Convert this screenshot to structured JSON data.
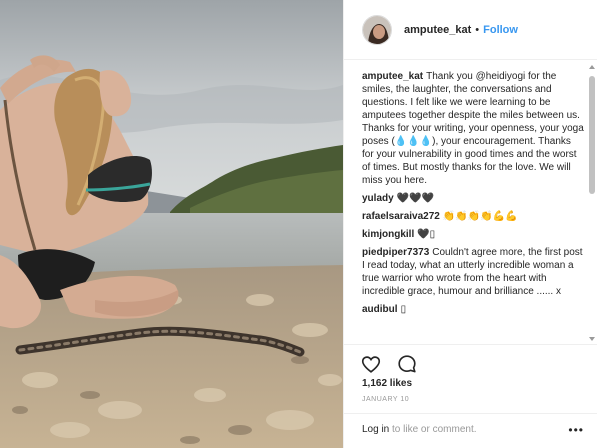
{
  "post": {
    "username": "amputee_kat",
    "separator": "•",
    "follow_label": "Follow"
  },
  "comments": [
    {
      "user": "amputee_kat",
      "text": "Thank you @heidiyogi for the smiles, the laughter, the conversations and questions. I felt like we were learning to be amputees together despite the miles between us. Thanks for your writing, your openness, your yoga poses (💧💧💧), your encouragement. Thanks for your vulnerability in good times and the worst of times. But mostly thanks for the love. We will miss you here."
    },
    {
      "user": "yulady",
      "text": "🖤🖤🖤"
    },
    {
      "user": "rafaelsaraiva272",
      "text": "👏👏👏👏💪💪"
    },
    {
      "user": "kimjongkill",
      "text": "🖤▯"
    },
    {
      "user": "piedpiper7373",
      "text": "Couldn't agree more, the first post I read today, what an utterly incredible woman a true warrior who wrote from the heart with incredible grace, humour and brilliance ...... x"
    },
    {
      "user": "audibul",
      "text": "▯"
    }
  ],
  "actions": {
    "likes": "1,162 likes",
    "date": "JANUARY 10",
    "login_link": "Log in",
    "login_rest": " to like or comment.",
    "more": "•••"
  },
  "icons": {
    "like": "heart-icon",
    "comment": "comment-bubble-icon",
    "more": "more-options-icon"
  },
  "colors": {
    "link_blue": "#3897f0",
    "text": "#262626",
    "muted": "#999999",
    "border": "#efefef"
  }
}
